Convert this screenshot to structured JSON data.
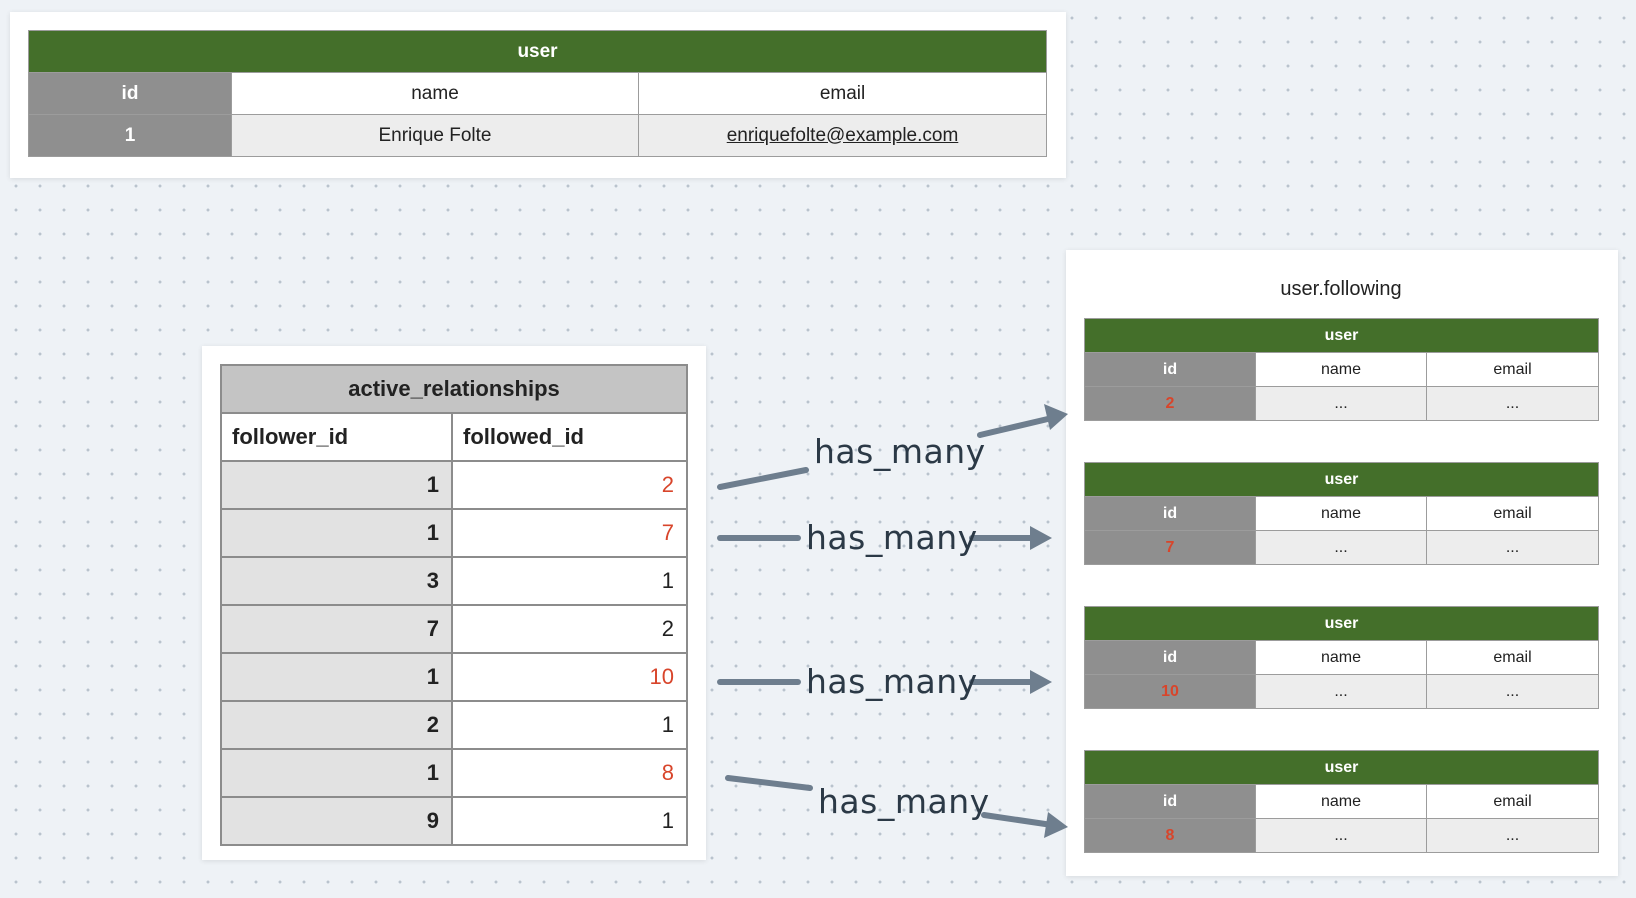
{
  "user_table": {
    "title": "user",
    "headers": [
      "id",
      "name",
      "email"
    ],
    "row": {
      "id": "1",
      "name": "Enrique Folte",
      "email": "enriquefolte@example.com"
    }
  },
  "relationships_table": {
    "title": "active_relationships",
    "headers": [
      "follower_id",
      "followed_id"
    ],
    "rows": [
      {
        "follower_id": "1",
        "followed_id": "2",
        "highlighted": true
      },
      {
        "follower_id": "1",
        "followed_id": "7",
        "highlighted": true
      },
      {
        "follower_id": "3",
        "followed_id": "1",
        "highlighted": false
      },
      {
        "follower_id": "7",
        "followed_id": "2",
        "highlighted": false
      },
      {
        "follower_id": "1",
        "followed_id": "10",
        "highlighted": true
      },
      {
        "follower_id": "2",
        "followed_id": "1",
        "highlighted": false
      },
      {
        "follower_id": "1",
        "followed_id": "8",
        "highlighted": true
      },
      {
        "follower_id": "9",
        "followed_id": "1",
        "highlighted": false
      }
    ]
  },
  "following": {
    "title": "user.following",
    "tables": [
      {
        "title": "user",
        "headers": [
          "id",
          "name",
          "email"
        ],
        "id": "2",
        "name": "...",
        "email": "..."
      },
      {
        "title": "user",
        "headers": [
          "id",
          "name",
          "email"
        ],
        "id": "7",
        "name": "...",
        "email": "..."
      },
      {
        "title": "user",
        "headers": [
          "id",
          "name",
          "email"
        ],
        "id": "10",
        "name": "...",
        "email": "..."
      },
      {
        "title": "user",
        "headers": [
          "id",
          "name",
          "email"
        ],
        "id": "8",
        "name": "...",
        "email": "..."
      }
    ]
  },
  "relation_labels": [
    "has_many",
    "has_many",
    "has_many",
    "has_many"
  ],
  "colors": {
    "header_green": "#446f2a",
    "id_gray": "#8f8f8f",
    "highlight_red": "#d8452b",
    "arrow": "#6e7e8e"
  }
}
